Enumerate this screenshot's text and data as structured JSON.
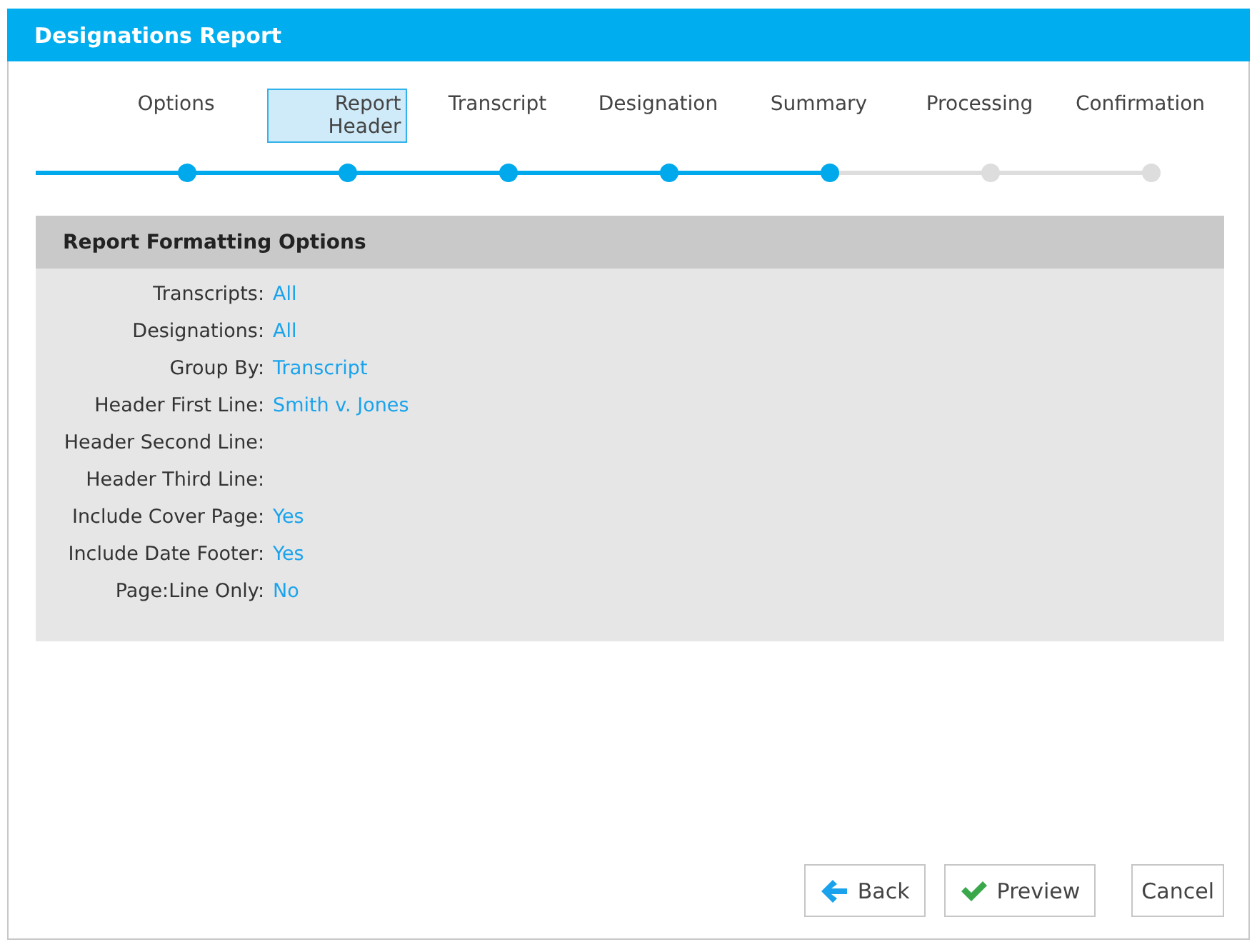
{
  "window": {
    "title": "Designations Report"
  },
  "steps": [
    {
      "label": "Options",
      "selected": false,
      "done": true
    },
    {
      "label": "Report Header",
      "selected": true,
      "done": true
    },
    {
      "label": "Transcript",
      "selected": false,
      "done": true
    },
    {
      "label": "Designation",
      "selected": false,
      "done": true
    },
    {
      "label": "Summary",
      "selected": false,
      "done": true
    },
    {
      "label": "Processing",
      "selected": false,
      "done": false
    },
    {
      "label": "Confirmation",
      "selected": false,
      "done": false
    }
  ],
  "panel": {
    "title": "Report Formatting Options",
    "fields": [
      {
        "label": "Transcripts:",
        "value": "All"
      },
      {
        "label": "Designations:",
        "value": "All"
      },
      {
        "label": "Group By:",
        "value": "Transcript"
      },
      {
        "label": "Header First Line:",
        "value": "Smith v. Jones"
      },
      {
        "label": "Header Second Line:"
      },
      {
        "label": "Header Third Line:"
      },
      {
        "label": "Include Cover Page:",
        "value": "Yes"
      },
      {
        "label": "Include Date Footer:",
        "value": "Yes"
      },
      {
        "label": "Page:Line Only:",
        "value": "No"
      }
    ]
  },
  "buttons": [
    {
      "kind": "back",
      "label": "Back"
    },
    {
      "kind": "preview",
      "label": "Preview"
    },
    {
      "kind": "cancel",
      "label": "Cancel"
    }
  ]
}
